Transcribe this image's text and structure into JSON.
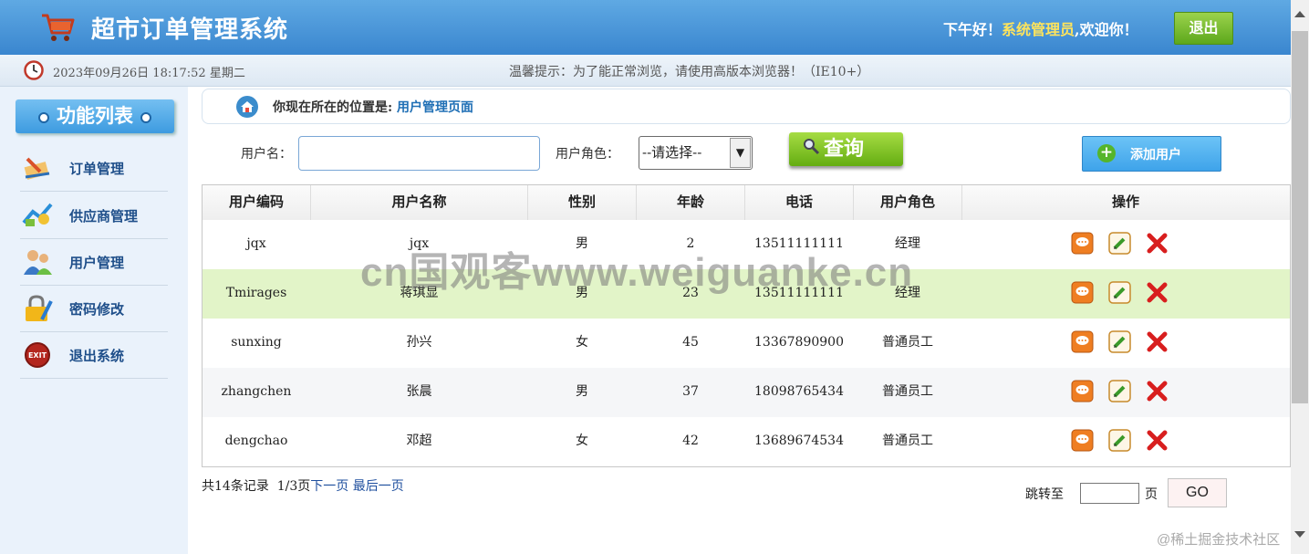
{
  "header": {
    "title": "超市订单管理系统",
    "greeting_prefix": "下午好！",
    "user": "系统管理员",
    "greeting_suffix": ",欢迎你！",
    "logout_label": "退出"
  },
  "infobar": {
    "datetime": "2023年09月26日 18:17:52 星期二",
    "tip": "温馨提示：为了能正常浏览，请使用高版本浏览器！（IE10+）"
  },
  "sidebar": {
    "title": "功能列表",
    "items": [
      {
        "label": "订单管理",
        "icon": "order-icon"
      },
      {
        "label": "供应商管理",
        "icon": "supplier-icon"
      },
      {
        "label": "用户管理",
        "icon": "users-icon"
      },
      {
        "label": "密码修改",
        "icon": "lock-icon"
      },
      {
        "label": "退出系统",
        "icon": "exit-icon"
      }
    ]
  },
  "breadcrumb": {
    "prefix": "你现在所在的位置是:",
    "page": "用户管理页面"
  },
  "search": {
    "username_label": "用户名：",
    "username_value": "",
    "role_label": "用户角色：",
    "role_selected": "--请选择--",
    "query_label": "查询",
    "add_label": "添加用户"
  },
  "table": {
    "headers": [
      "用户编码",
      "用户名称",
      "性别",
      "年龄",
      "电话",
      "用户角色",
      "操作"
    ],
    "rows": [
      {
        "code": "jqx",
        "name": "jqx",
        "gender": "男",
        "age": "2",
        "phone": "13511111111",
        "role": "经理"
      },
      {
        "code": "Tmirages",
        "name": "蒋琪显",
        "gender": "男",
        "age": "23",
        "phone": "13511111111",
        "role": "经理"
      },
      {
        "code": "sunxing",
        "name": "孙兴",
        "gender": "女",
        "age": "45",
        "phone": "13367890900",
        "role": "普通员工"
      },
      {
        "code": "zhangchen",
        "name": "张晨",
        "gender": "男",
        "age": "37",
        "phone": "18098765434",
        "role": "普通员工"
      },
      {
        "code": "dengchao",
        "name": "邓超",
        "gender": "女",
        "age": "42",
        "phone": "13689674534",
        "role": "普通员工"
      }
    ]
  },
  "pager": {
    "total": "共14条记录",
    "current": "1/3页",
    "next": "下一页",
    "last": "最后一页",
    "jump_label": "跳转至",
    "jump_value": "",
    "page_unit": "页",
    "go_label": "GO"
  },
  "watermark": "cn国观客www.weiguanke.cn",
  "corner_mark": "@稀土掘金技术社区",
  "colors": {
    "header_blue": "#3a86cf",
    "user_highlight": "#ffe45c",
    "logout_green": "#5da81c",
    "row_highlight": "#e2f4c8",
    "row_alt": "#f5f6f8",
    "link_blue": "#1f6fb5"
  }
}
